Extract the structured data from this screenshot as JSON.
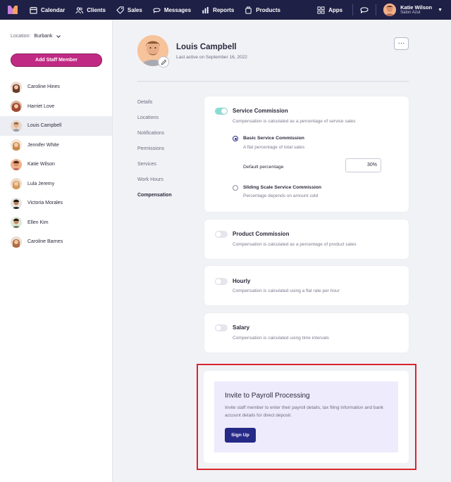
{
  "nav": {
    "items": [
      {
        "label": "Calendar",
        "icon": "calendar-icon"
      },
      {
        "label": "Clients",
        "icon": "users-icon"
      },
      {
        "label": "Sales",
        "icon": "tag-icon"
      },
      {
        "label": "Messages",
        "icon": "message-icon"
      },
      {
        "label": "Reports",
        "icon": "chart-icon"
      },
      {
        "label": "Products",
        "icon": "products-icon"
      }
    ],
    "apps_label": "Apps",
    "user_name": "Katie Wilson",
    "user_salon": "Salon Azul",
    "brand_color": "#1f2046"
  },
  "sidebar": {
    "location_label": "Location:",
    "location_value": "Burbank",
    "add_button": "Add Staff Member",
    "staff": [
      {
        "name": "Caroline Hines"
      },
      {
        "name": "Harriet Love"
      },
      {
        "name": "Louis Campbell"
      },
      {
        "name": "Jennifer White"
      },
      {
        "name": "Katie Wilson"
      },
      {
        "name": "Lula Jeremy"
      },
      {
        "name": "Victoria Morales"
      },
      {
        "name": "Ellen Kim"
      },
      {
        "name": "Caroline Barnes"
      }
    ]
  },
  "profile": {
    "name": "Louis Campbell",
    "last_active": "Last active on September 16, 2022",
    "more": "···"
  },
  "tabs": [
    "Details",
    "Locations",
    "Notifications",
    "Permissions",
    "Services",
    "Work Hours",
    "Compensation"
  ],
  "service_commission": {
    "title": "Service Commission",
    "desc": "Compensation is calculated as a percentage of service sales",
    "enabled": true,
    "basic_title": "Basic Service Commission",
    "basic_desc": "A flat percentage of total sales",
    "default_label": "Default percentage",
    "default_value": "30%",
    "sliding_title": "Sliding Scale Service Commission",
    "sliding_desc": "Percentage depends on amount sold"
  },
  "product_commission": {
    "title": "Product Commission",
    "desc": "Compensation is calculated as a percentage of product sales",
    "enabled": false
  },
  "hourly": {
    "title": "Hourly",
    "desc": "Compensation is calculated using a flat rate per hour",
    "enabled": false
  },
  "salary": {
    "title": "Salary",
    "desc": "Compensation is calculated using time intervals",
    "enabled": false
  },
  "payroll": {
    "title": "Invite to Payroll Processing",
    "desc": "Invite staff member to enter their payroll details, tax filing information and bank account details for direct deposit.",
    "button": "Sign Up"
  }
}
